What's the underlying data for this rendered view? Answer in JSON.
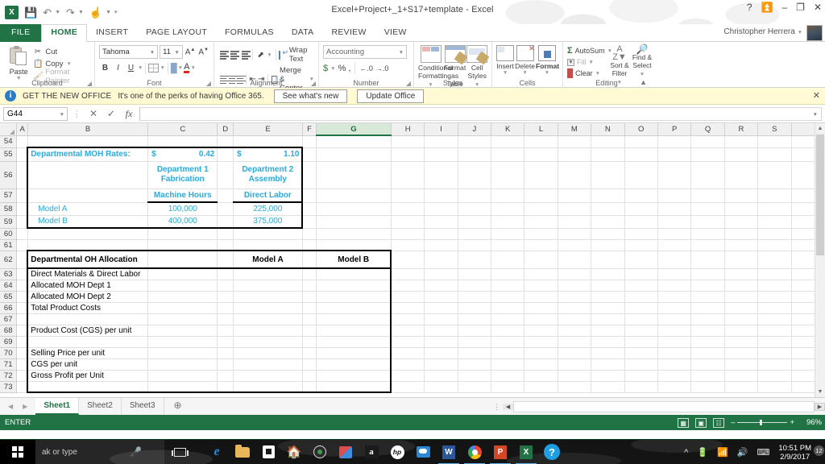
{
  "window": {
    "title": "Excel+Project+_1+S17+template - Excel",
    "help_icon": "?",
    "ribbon_display_icon": "ribbon-display-options",
    "minimize_icon": "–",
    "restore_icon": "restore",
    "close_icon": "✕",
    "user_name": "Christopher Herrera"
  },
  "quick_access": {
    "logo": "X",
    "save_icon": "save-icon",
    "undo_icon": "undo-icon",
    "redo_icon": "redo-icon",
    "touch_icon": "touch-mode-icon",
    "customize_icon": "customize-icon"
  },
  "tabs": [
    {
      "label": "FILE"
    },
    {
      "label": "HOME"
    },
    {
      "label": "INSERT"
    },
    {
      "label": "PAGE LAYOUT"
    },
    {
      "label": "FORMULAS"
    },
    {
      "label": "DATA"
    },
    {
      "label": "REVIEW"
    },
    {
      "label": "VIEW"
    }
  ],
  "ribbon": {
    "clipboard": {
      "group_label": "Clipboard",
      "paste": "Paste",
      "cut": "Cut",
      "copy": "Copy",
      "format_painter": "Format Painter"
    },
    "font": {
      "group_label": "Font",
      "font_name": "Tahoma",
      "font_size": "11",
      "grow_font": "A",
      "shrink_font": "A",
      "bold": "B",
      "italic": "I",
      "underline": "U",
      "borders": "borders-icon",
      "fill_color": "fill-color-icon",
      "font_color": "A"
    },
    "alignment": {
      "group_label": "Alignment",
      "wrap_text": "Wrap Text",
      "merge_center": "Merge & Center",
      "orientation": "orientation-icon"
    },
    "number": {
      "group_label": "Number",
      "format": "Accounting",
      "currency": "$",
      "percent": "%",
      "comma": ",",
      "increase_decimal": ".00",
      "decrease_decimal": ".00"
    },
    "styles": {
      "group_label": "Styles",
      "conditional_formatting": "Conditional Formatting",
      "format_as_table": "Format as Table",
      "cell_styles": "Cell Styles"
    },
    "cells": {
      "group_label": "Cells",
      "insert": "Insert",
      "delete": "Delete",
      "format": "Format"
    },
    "editing": {
      "group_label": "Editing",
      "autosum": "AutoSum",
      "fill": "Fill",
      "clear": "Clear",
      "sort_filter": "Sort & Filter",
      "find_select": "Find & Select"
    }
  },
  "notification": {
    "icon": "info-icon",
    "headline": "GET THE NEW OFFICE",
    "message": "It's one of the perks of having Office 365.",
    "button_see": "See what's new",
    "button_update": "Update Office",
    "close": "✕"
  },
  "formula_bar": {
    "name_box": "G44",
    "cancel_icon": "✕",
    "enter_icon": "✓",
    "function_icon": "fx",
    "formula_value": ""
  },
  "grid": {
    "columns": [
      "A",
      "B",
      "C",
      "D",
      "E",
      "F",
      "G",
      "H",
      "I",
      "J",
      "K",
      "L",
      "M",
      "N",
      "O",
      "P",
      "Q",
      "R",
      "S"
    ],
    "selected_column": "G",
    "selected_cell": "G44",
    "rows": [
      "54",
      "55",
      "56",
      "57",
      "58",
      "59",
      "60",
      "61",
      "62",
      "63",
      "64",
      "65",
      "66",
      "67",
      "68",
      "69",
      "70",
      "71",
      "72",
      "73"
    ],
    "table1": {
      "title": "Departmental MOH Rates:",
      "rate_currency_1": "$",
      "rate_value_1": "0.42",
      "rate_currency_2": "$",
      "rate_value_2": "1.10",
      "dept1_line1": "Department 1",
      "dept1_line2": "Fabrication",
      "dept2_line1": "Department 2",
      "dept2_line2": "Assembly",
      "driver1": "Machine Hours",
      "driver2": "Direct Labor",
      "model_a_label": "Model A",
      "model_a_c": "100,000",
      "model_a_e": "225,000",
      "model_b_label": "Model B",
      "model_b_c": "400,000",
      "model_b_e": "375,000"
    },
    "table2": {
      "title": "Departmental OH Allocation",
      "col_model_a": "Model A",
      "col_model_b": "Model B",
      "rows": [
        "Direct Materials & Direct Labor",
        "Allocated MOH Dept 1",
        "Allocated MOH Dept 2",
        "Total Product Costs",
        "",
        "Product Cost (CGS) per unit",
        "",
        "Selling Price per unit",
        "CGS per unit",
        "Gross Profit per Unit"
      ]
    }
  },
  "sheet_tabs": {
    "prev_icon": "◀",
    "next_icon": "▶",
    "sheets": [
      "Sheet1",
      "Sheet2",
      "Sheet3"
    ],
    "active_sheet": "Sheet1",
    "add_sheet": "+"
  },
  "status_bar": {
    "mode": "ENTER",
    "normal_view_icon": "normal-view-icon",
    "page_layout_icon": "page-layout-icon",
    "page_break_icon": "page-break-preview-icon",
    "zoom_out": "–",
    "zoom_in": "+",
    "zoom_level": "96%"
  },
  "taskbar": {
    "start_icon": "windows-start-icon",
    "search_placeholder": "ak or type",
    "mic_icon": "microphone-icon",
    "task_view_icon": "task-view-icon",
    "apps": [
      {
        "name": "edge-icon"
      },
      {
        "name": "file-explorer-icon"
      },
      {
        "name": "microsoft-store-icon"
      },
      {
        "name": "home-icon"
      },
      {
        "name": "media-player-icon"
      },
      {
        "name": "puzzle-app-icon"
      },
      {
        "name": "amazon-icon"
      },
      {
        "name": "hp-icon"
      },
      {
        "name": "onedrive-icon"
      },
      {
        "name": "word-icon"
      },
      {
        "name": "chrome-icon"
      },
      {
        "name": "powerpoint-icon"
      },
      {
        "name": "excel-icon"
      },
      {
        "name": "help-icon"
      }
    ],
    "tray": {
      "show_hidden_icon": "^",
      "battery_icon": "battery-icon",
      "wifi_icon": "wifi-icon",
      "volume_icon": "volume-icon",
      "keyboard_icon": "keyboard-icon",
      "time": "10:51 PM",
      "date": "2/9/2017",
      "notification_count": "12"
    }
  },
  "colors": {
    "excel_green": "#217346",
    "cyan_text": "#29ABE2",
    "notification_bg": "#fff9d4"
  }
}
